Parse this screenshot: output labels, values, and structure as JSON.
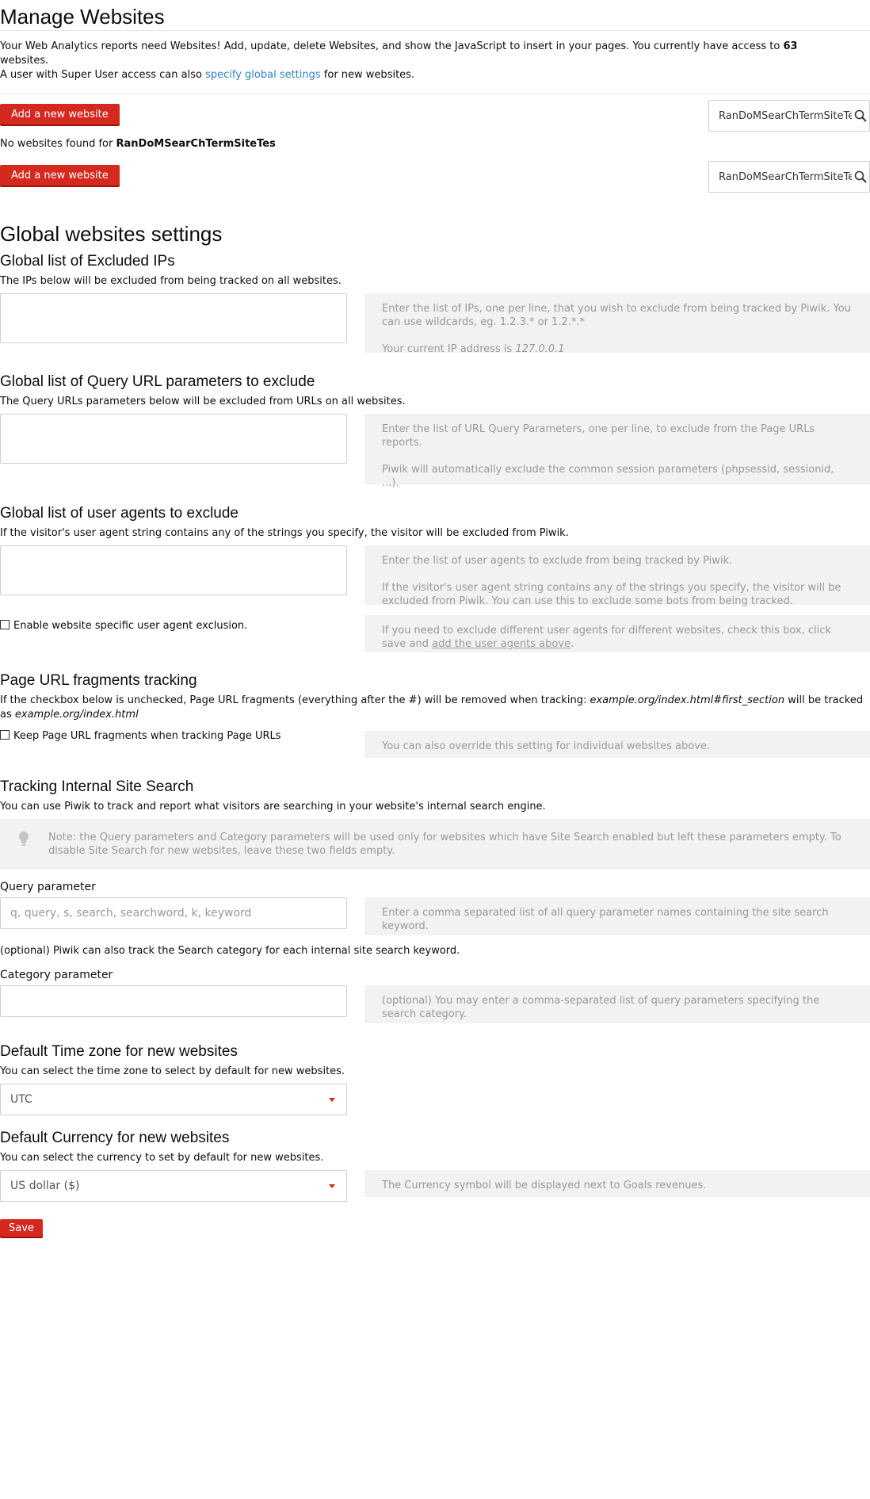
{
  "header": {
    "title": "Manage Websites",
    "intro_1": "Your Web Analytics reports need Websites! Add, update, delete Websites, and show the JavaScript to insert in your pages. You currently have access to",
    "site_count": "63",
    "intro_2": "websites.",
    "intro_3": "A user with Super User access can also",
    "intro_link": "specify global settings",
    "intro_4": "for new websites."
  },
  "toolbar": {
    "add_label": "Add a new website",
    "search_value": "RanDoMSearChTermSiteTes",
    "no_results_prefix": "No websites found for",
    "no_results_term": "RanDoMSearChTermSiteTes"
  },
  "global": {
    "title": "Global websites settings",
    "excluded_ips": {
      "title": "Global list of Excluded IPs",
      "desc": "The IPs below will be excluded from being tracked on all websites.",
      "help_1": "Enter the list of IPs, one per line, that you wish to exclude from being tracked by Piwik. You can use wildcards, eg. 1.2.3.* or 1.2.*.*",
      "help_2_prefix": "Your current IP address is",
      "help_2_ip": "127.0.0.1"
    },
    "excluded_params": {
      "title": "Global list of Query URL parameters to exclude",
      "desc": "The Query URLs parameters below will be excluded from URLs on all websites.",
      "help_1": "Enter the list of URL Query Parameters, one per line, to exclude from the Page URLs reports.",
      "help_2": "Piwik will automatically exclude the common session parameters (phpsessid, sessionid, ...)."
    },
    "excluded_agents": {
      "title": "Global list of user agents to exclude",
      "desc": "If the visitor's user agent string contains any of the strings you specify, the visitor will be excluded from Piwik.",
      "help_1": "Enter the list of user agents to exclude from being tracked by Piwik.",
      "help_2": "If the visitor's user agent string contains any of the strings you specify, the visitor will be excluded from Piwik. You can use this to exclude some bots from being tracked.",
      "checkbox_label": "Enable website specific user agent exclusion.",
      "checkbox_help_prefix": "If you need to exclude different user agents for different websites, check this box, click save and",
      "checkbox_help_link": "add the user agents above",
      "checkbox_help_suffix": "."
    },
    "fragments": {
      "title": "Page URL fragments tracking",
      "desc_1": "If the checkbox below is unchecked, Page URL fragments (everything after the #) will be removed when tracking:",
      "desc_example_1": "example.org/index.html#first_section",
      "desc_2": "will be tracked as",
      "desc_example_2": "example.org/index.html",
      "checkbox_label": "Keep Page URL fragments when tracking Page URLs",
      "help": "You can also override this setting for individual websites above."
    },
    "site_search": {
      "title": "Tracking Internal Site Search",
      "desc": "You can use Piwik to track and report what visitors are searching in your website's internal search engine.",
      "note": "Note: the Query parameters and Category parameters will be used only for websites which have Site Search enabled but left these parameters empty. To disable Site Search for new websites, leave these two fields empty.",
      "query_label": "Query parameter",
      "query_placeholder": "q, query, s, search, searchword, k, keyword",
      "query_help": "Enter a comma separated list of all query parameter names containing the site search keyword.",
      "optional_text": "(optional) Piwik can also track the Search category for each internal site search keyword.",
      "category_label": "Category parameter",
      "category_help": "(optional) You may enter a comma-separated list of query parameters specifying the search category."
    },
    "timezone": {
      "title": "Default Time zone for new websites",
      "desc": "You can select the time zone to select by default for new websites.",
      "value": "UTC"
    },
    "currency": {
      "title": "Default Currency for new websites",
      "desc": "You can select the currency to set by default for new websites.",
      "value": "US dollar ($)",
      "help": "The Currency symbol will be displayed next to Goals revenues."
    },
    "save_label": "Save"
  },
  "colors": {
    "accent_red": "#d4291f",
    "link_blue": "#2e84c6",
    "help_bg": "#f2f2f2"
  }
}
